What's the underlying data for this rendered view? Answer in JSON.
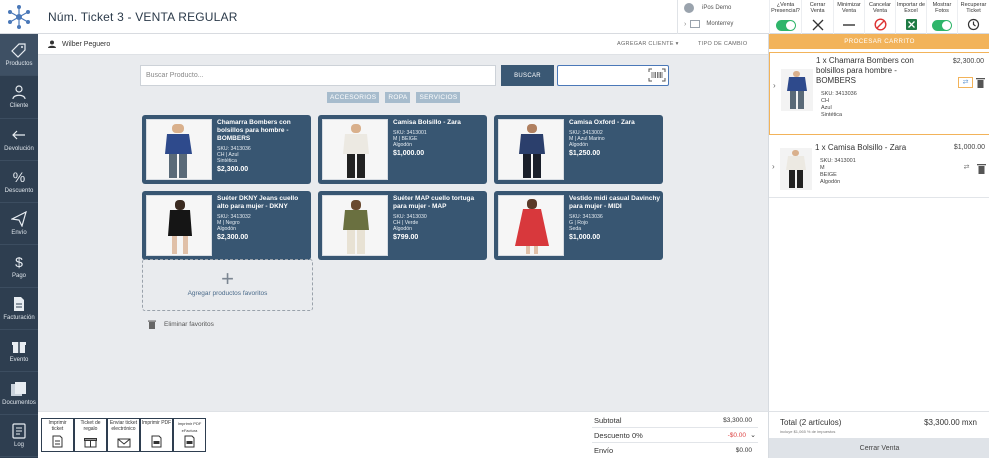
{
  "header": {
    "title": "Núm. Ticket 3 - VENTA REGULAR",
    "user_name": "iPos Demo",
    "store_name": "Monterrey",
    "tools": [
      {
        "label": "¿Venta Presencial?",
        "icon": "toggle-on"
      },
      {
        "label": "Cerrar Venta",
        "icon": "x-icon"
      },
      {
        "label": "Minimizar Venta",
        "icon": "minus-icon"
      },
      {
        "label": "Cancelar Venta",
        "icon": "cancel-icon"
      },
      {
        "label": "Importar de Excel",
        "icon": "excel-icon"
      },
      {
        "label": "Mostrar Fotos",
        "icon": "toggle-on"
      },
      {
        "label": "Recuperar Ticket",
        "icon": "refresh-icon"
      }
    ]
  },
  "sidebar": {
    "items": [
      {
        "label": "Productos",
        "icon": "tag-icon"
      },
      {
        "label": "Cliente",
        "icon": "person-icon"
      },
      {
        "label": "Devolución",
        "icon": "arrow-left-icon"
      },
      {
        "label": "Descuento",
        "icon": "percent-icon"
      },
      {
        "label": "Envío",
        "icon": "send-icon"
      },
      {
        "label": "Pago",
        "icon": "dollar-icon"
      },
      {
        "label": "Facturación",
        "icon": "document-icon"
      },
      {
        "label": "Evento",
        "icon": "gift-icon"
      },
      {
        "label": "Documentos",
        "icon": "documents-icon"
      },
      {
        "label": "Log",
        "icon": "log-icon"
      }
    ]
  },
  "client_bar": {
    "client_name": "Wilber Peguero",
    "add_client": "AGREGAR CLIENTE ▾",
    "exchange_type": "TIPO DE CAMBIO"
  },
  "search": {
    "placeholder": "Buscar Producto...",
    "button": "BUSCAR",
    "barcode_value": ""
  },
  "categories": [
    "ACCESORIOS",
    "ROPA",
    "SERVICIOS"
  ],
  "products": [
    {
      "name": "Chamarra Bombers con bolsillos para hombre - BOMBERS",
      "sku": "SKU: 3413036",
      "meta1": "CH | Azul",
      "meta2": "Sintética",
      "price": "$2,300.00"
    },
    {
      "name": "Camisa Bolsillo - Zara",
      "sku": "SKU: 3413001",
      "meta1": "M | BEIGE",
      "meta2": "Algodón",
      "price": "$1,000.00"
    },
    {
      "name": "Camisa Oxford - Zara",
      "sku": "SKU: 3413002",
      "meta1": "M | Azul Marino",
      "meta2": "Algodón",
      "price": "$1,250.00"
    },
    {
      "name": "Suéter DKNY Jeans cuello alto para mujer - DKNY",
      "sku": "SKU: 3413032",
      "meta1": "M | Negro",
      "meta2": "Algodón",
      "price": "$2,300.00"
    },
    {
      "name": "Suéter MAP cuello tortuga para mujer - MAP",
      "sku": "SKU: 3413030",
      "meta1": "CH | Verde",
      "meta2": "Algodón",
      "price": "$799.00"
    },
    {
      "name": "Vestido midi casual Davinchy para mujer - MIDI",
      "sku": "SKU: 3413036",
      "meta1": "G | Rojo",
      "meta2": "Seda",
      "price": "$1,000.00"
    }
  ],
  "favorites": {
    "add_label": "Agregar productos favoritos",
    "delete_label": "Eliminar favoritos"
  },
  "cart": {
    "process_button": "PROCESAR CARRITO",
    "items": [
      {
        "name": "1 x Chamarra Bombers con bolsillos para hombre - BOMBERS",
        "price": "$2,300.00",
        "sku": "SKU: 3413036",
        "size": "CH",
        "color": "Azul",
        "material": "Sintética"
      },
      {
        "name": "1 x Camisa Bolsillo - Zara",
        "price": "$1,000.00",
        "sku": "SKU: 3413001",
        "size": "M",
        "color": "BEIGE",
        "material": "Algodón"
      }
    ],
    "total_label": "Total (2 artículos)",
    "total_value": "$3,300.00 mxn",
    "tax_note": "incluye $1,065 % de impuestos",
    "close_button": "Cerrar Venta"
  },
  "footer": {
    "buttons": [
      {
        "label": "Imprimir ticket",
        "icon": "print-ticket-icon"
      },
      {
        "label": "Ticket de regalo",
        "icon": "gift-ticket-icon"
      },
      {
        "label": "Enviar ticket electrónico",
        "icon": "email-icon"
      },
      {
        "label": "Imprimir PDF",
        "icon": "pdf-icon"
      },
      {
        "label": "Imprimir PDF eFactura",
        "icon": "pdf-invoice-icon"
      }
    ],
    "subtotal_label": "Subtotal",
    "subtotal_value": "$3,300.00",
    "discount_label": "Descuento 0%",
    "discount_value": "-$0.00",
    "shipping_label": "Envío",
    "shipping_value": "$0.00"
  },
  "colors": {
    "sidebar": "#2e3e50",
    "card": "#385672",
    "accent_orange": "#f2b35a",
    "toggle_green": "#2fb56a",
    "category_tag": "#a7bccd"
  }
}
